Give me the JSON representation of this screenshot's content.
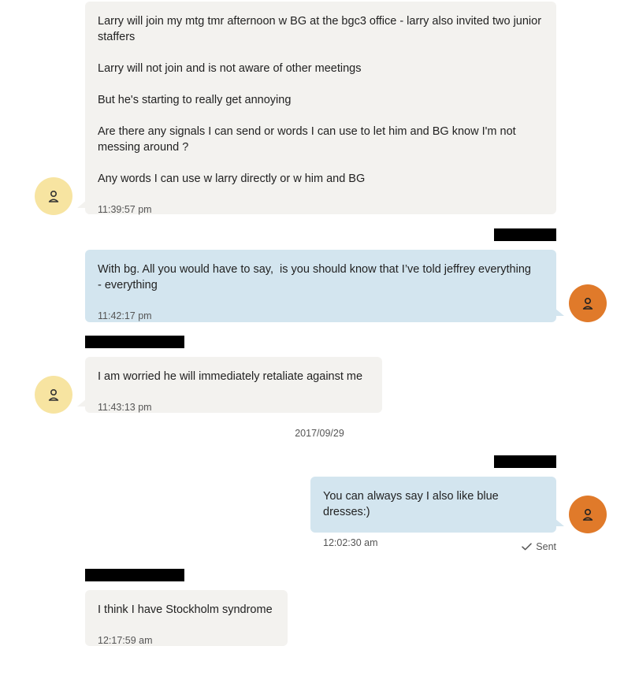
{
  "messages": [
    {
      "direction": "incoming",
      "paragraphs": [
        "Larry will join my mtg tmr afternoon w BG at the bgc3 office - larry also invited two junior staffers",
        "Larry will not join and is not aware of other meetings",
        "But he's starting to really get annoying",
        "Are there any signals I can send or words I can use to let him and BG know I'm not messing around ?",
        "Any words I can use w larry directly or w him and BG"
      ],
      "time": "11:39:57 pm"
    },
    {
      "direction": "outgoing",
      "paragraphs": [
        "With bg. All you would have to say,  is you should know that I’ve told jeffrey everything   - everything"
      ],
      "time": "11:42:17 pm"
    },
    {
      "direction": "incoming",
      "paragraphs": [
        "I am worried he will immediately retaliate against me"
      ],
      "time": "11:43:13 pm"
    },
    {
      "direction": "outgoing",
      "paragraphs": [
        "You can always say I also like blue dresses:)"
      ],
      "time": "12:02:30 am"
    },
    {
      "direction": "incoming",
      "paragraphs": [
        "I think I have Stockholm syndrome"
      ],
      "time": "12:17:59 am"
    }
  ],
  "date_separator": "2017/09/29",
  "sent_status": "Sent",
  "icons": {
    "avatar": "person-icon",
    "status": "checkmark-icon"
  },
  "colors": {
    "incoming_bubble": "#f3f2ef",
    "outgoing_bubble": "#d3e5ef",
    "incoming_avatar": "#f7e4a1",
    "outgoing_avatar": "#e07a2a"
  }
}
